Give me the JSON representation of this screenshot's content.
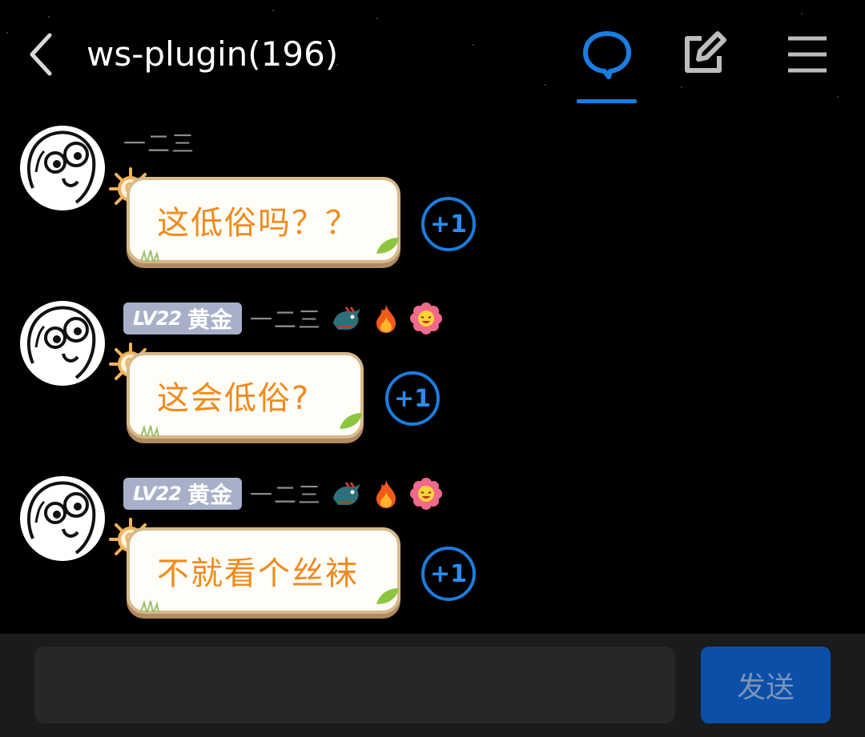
{
  "header": {
    "title": "ws-plugin(196)",
    "icons": [
      "back-icon",
      "chat-bubble-icon",
      "edit-icon",
      "menu-icon"
    ],
    "active_tab_color": "#1a7de0"
  },
  "messages": [
    {
      "nickname": "一二三",
      "text": "这低俗吗？？",
      "plus_one": "+1",
      "has_badge": false
    },
    {
      "badge": {
        "level": "LV22",
        "title": "黄金"
      },
      "nickname": "一二三",
      "emojis": [
        "dragon-emoji",
        "fire-emoji",
        "flower-emoji"
      ],
      "text": "这会低俗?",
      "plus_one": "+1",
      "has_badge": true
    },
    {
      "badge": {
        "level": "LV22",
        "title": "黄金"
      },
      "nickname": "一二三",
      "emojis": [
        "dragon-emoji",
        "fire-emoji",
        "flower-emoji"
      ],
      "text": "不就看个丝袜",
      "plus_one": "+1",
      "has_badge": true
    }
  ],
  "composer": {
    "placeholder": "",
    "send_label": "发送"
  },
  "colors": {
    "background": "#000000",
    "accent": "#1a7de0",
    "bubble_text": "#f08a1c",
    "bubble_border": "#d8b98a",
    "send_button": "#0b4fa8"
  }
}
